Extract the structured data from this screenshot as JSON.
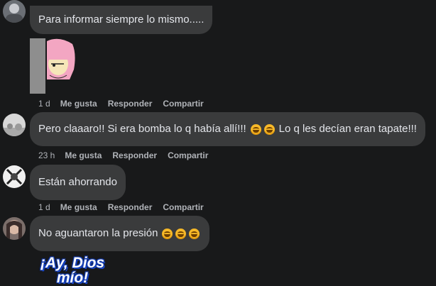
{
  "comments": [
    {
      "text": "Para informar siempre lo mismo.....",
      "time": "1 d",
      "like": "Me gusta",
      "reply": "Responder",
      "share": "Compartir"
    },
    {
      "text_before": "Pero claaaro!! Si era bomba lo q había allí!!!",
      "text_after": "Lo q les decían eran tapate!!!",
      "emoji": "rolling-on-floor-laughing",
      "time": "23 h",
      "like": "Me gusta",
      "reply": "Responder",
      "share": "Compartir"
    },
    {
      "text": "Están ahorrando",
      "time": "1 d",
      "like": "Me gusta",
      "reply": "Responder",
      "share": "Compartir"
    },
    {
      "text": "No aguantaron la presión",
      "emoji": "rolling-on-floor-laughing",
      "gif_text_line1": "¡Ay, Dios",
      "gif_text_line2": "mío!"
    }
  ],
  "colors": {
    "background": "#18191a",
    "bubble": "#3a3b3c",
    "text": "#e4e6eb",
    "meta": "#b0b3b8"
  }
}
